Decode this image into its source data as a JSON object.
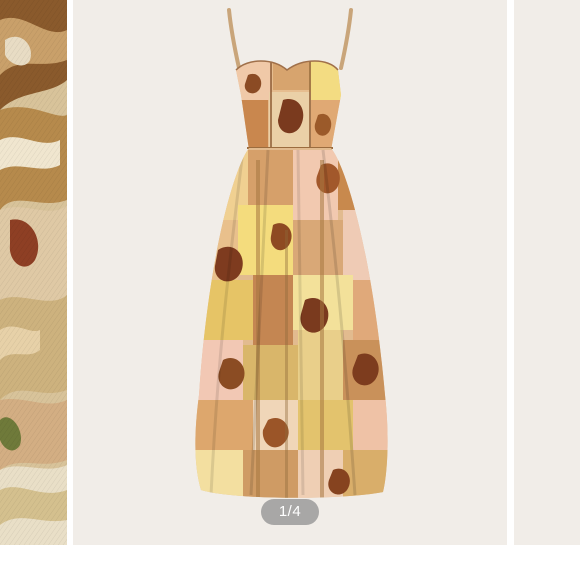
{
  "carousel": {
    "current": "1",
    "separator": "/",
    "total": "4",
    "slides": [
      {
        "content": "paisley-fabric-closeup"
      },
      {
        "content": "paisley-patchwork-midi-dress"
      },
      {
        "content": "blank-next-image"
      }
    ]
  },
  "colors": {
    "main_background": "#f1ede8",
    "counter_background": "#8c8c8c",
    "dress_base": "#e2bb8f"
  }
}
